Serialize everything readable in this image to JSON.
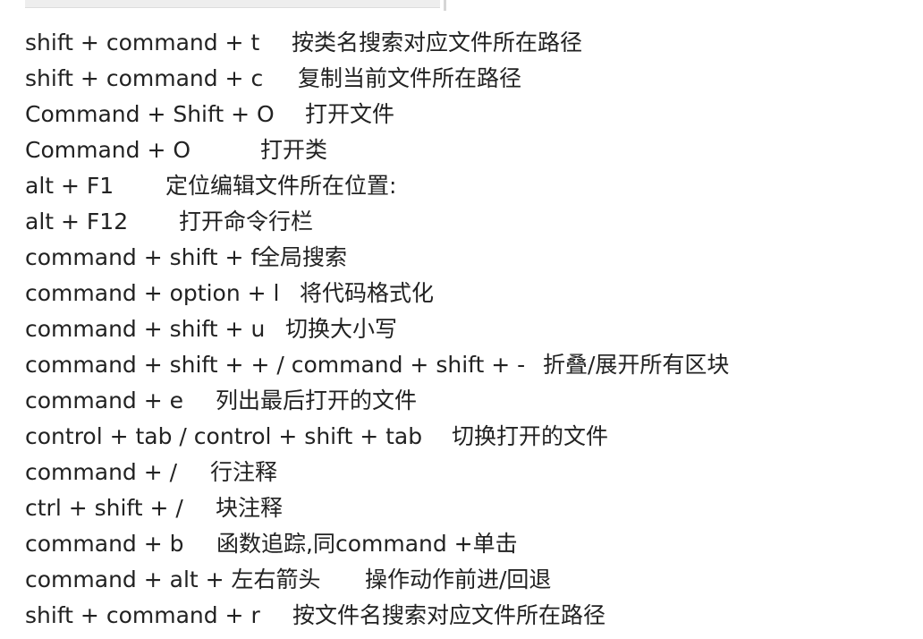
{
  "shortcuts": [
    {
      "keys": "shift + command + t",
      "desc": "按类名搜索对应文件所在路径"
    },
    {
      "keys": "shift + command + c",
      "desc": "复制当前文件所在路径"
    },
    {
      "keys": "Command + Shift + O",
      "desc": "打开文件"
    },
    {
      "keys": "Command + O",
      "desc": "打开类"
    },
    {
      "keys": "alt + F1",
      "desc": "定位编辑文件所在位置:"
    },
    {
      "keys": "alt + F12",
      "desc": "打开命令行栏"
    },
    {
      "keys": "command + shift + f",
      "desc": "全局搜索"
    },
    {
      "keys": "command + option + l",
      "desc": "将代码格式化"
    },
    {
      "keys": "command + shift + u",
      "desc": "切换大小写"
    },
    {
      "keys": "command + shift + + / command + shift + -",
      "desc": "折叠/展开所有区块"
    },
    {
      "keys": "command + e",
      "desc": "列出最后打开的文件"
    },
    {
      "keys": "control + tab  / control + shift + tab",
      "desc": "切换打开的文件"
    },
    {
      "keys": "command + /",
      "desc": "行注释"
    },
    {
      "keys": "ctrl + shift + /",
      "desc": "块注释"
    },
    {
      "keys": "command + b",
      "desc": "函数追踪,同command +单击"
    },
    {
      "keys": "command + alt + 左右箭头",
      "desc": "操作动作前进/回退"
    },
    {
      "keys": "shift + command + r",
      "desc": "按文件名搜索对应文件所在路径"
    }
  ]
}
